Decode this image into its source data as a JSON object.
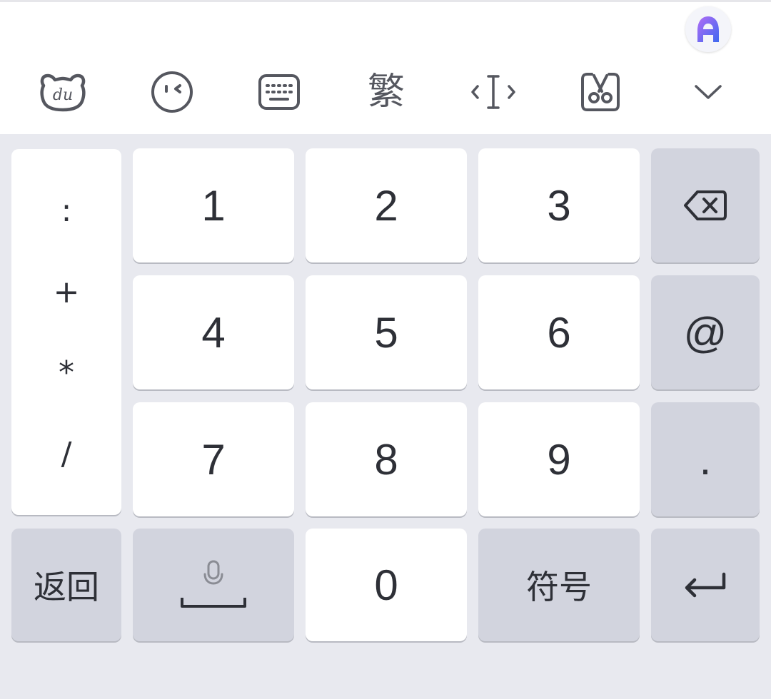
{
  "app": "Baidu Input Method",
  "toolbar": {
    "items": [
      {
        "name": "du-logo-icon"
      },
      {
        "name": "emoji-icon"
      },
      {
        "name": "keyboard-icon"
      },
      {
        "name": "traditional-chinese",
        "label": "繁"
      },
      {
        "name": "cursor-move-icon"
      },
      {
        "name": "clipboard-scissors-icon"
      },
      {
        "name": "chevron-down-icon"
      }
    ],
    "traditional_label": "繁"
  },
  "keyboard": {
    "symbols": [
      ":",
      "+",
      "*",
      "/"
    ],
    "digits": {
      "k1": "1",
      "k2": "2",
      "k3": "3",
      "k4": "4",
      "k5": "5",
      "k6": "6",
      "k7": "7",
      "k8": "8",
      "k9": "9",
      "k0": "0"
    },
    "at_key": "@",
    "dot_key": ".",
    "back_label": "返回",
    "symbols_label": "符号",
    "icons": {
      "backspace": "backspace-icon",
      "mic": "microphone-icon",
      "enter": "enter-icon"
    }
  },
  "colors": {
    "key_white": "#ffffff",
    "key_gray": "#d2d4de",
    "keyboard_bg": "#e8e9ef",
    "assistant_accent": "#5b6cf0"
  }
}
